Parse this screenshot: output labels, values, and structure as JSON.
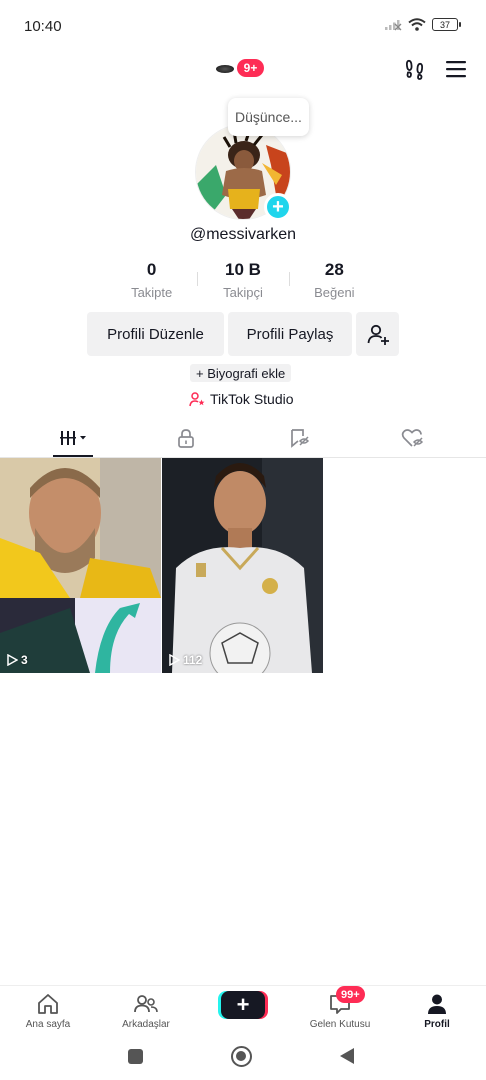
{
  "status_bar": {
    "time": "10:40",
    "battery": "37"
  },
  "top_bar": {
    "notification_badge": "9+"
  },
  "profile": {
    "thought_bubble": "Düşünce...",
    "username": "@messivarken",
    "stats": [
      {
        "value": "0",
        "label": "Takipte"
      },
      {
        "value": "10 B",
        "label": "Takipçi"
      },
      {
        "value": "28",
        "label": "Beğeni"
      }
    ],
    "edit_label": "Profili Düzenle",
    "share_label": "Profili Paylaş",
    "bio_add_label": "+ Biyografi ekle",
    "studio_label": "TikTok Studio"
  },
  "videos": [
    {
      "views": "3"
    },
    {
      "views": "112"
    }
  ],
  "bottom_nav": {
    "home": "Ana sayfa",
    "friends": "Arkadaşlar",
    "inbox": "Gelen Kutusu",
    "inbox_badge": "99+",
    "profile": "Profil"
  },
  "colors": {
    "accent": "#fe2c55",
    "cyan": "#20d5ec",
    "text": "#161823"
  }
}
